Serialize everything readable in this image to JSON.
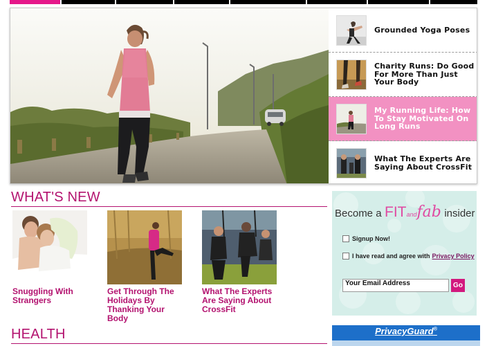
{
  "nav": {
    "items": [
      {
        "active": true
      },
      {
        "active": false
      },
      {
        "active": false
      },
      {
        "active": false
      },
      {
        "active": false
      },
      {
        "active": false
      },
      {
        "active": false
      },
      {
        "active": false
      }
    ]
  },
  "hero": {
    "image_icon": "woman-running-photo",
    "items": [
      {
        "title": "Grounded Yoga Poses",
        "active": false,
        "thumb_icon": "yoga-photo"
      },
      {
        "title": "Charity Runs: Do Good For More Than Just Your Body",
        "active": false,
        "thumb_icon": "runners-legs-photo"
      },
      {
        "title": "My Running Life: How To Stay Motivated On Long Runs",
        "active": true,
        "thumb_icon": "runner-photo"
      },
      {
        "title": "What The Experts Are Saying About CrossFit",
        "active": false,
        "thumb_icon": "crossfit-photo"
      }
    ]
  },
  "whats_new": {
    "heading": "WHAT'S NEW",
    "items": [
      {
        "title": "Snuggling With Strangers",
        "thumb_icon": "couple-in-bed-photo"
      },
      {
        "title": "Get Through The Holidays By Thanking Your Body",
        "thumb_icon": "woman-stretching-photo"
      },
      {
        "title": "What The Experts Are Saying About CrossFit",
        "thumb_icon": "crossfit-photo"
      }
    ]
  },
  "health": {
    "heading": "HEALTH"
  },
  "signup": {
    "brand_prefix": "Become a",
    "brand_fit": "FIT",
    "brand_and": "and",
    "brand_fab": "fab",
    "brand_suffix": "insider",
    "signup_label": "Signup Now!",
    "agree_label": "I have read and agree with",
    "privacy_link": "Privacy Policy",
    "email_placeholder": "Your Email Address",
    "go_label": "Go"
  },
  "ad": {
    "text": "PrivacyGuard",
    "mark": "®"
  },
  "colors": {
    "accent": "#e6188a",
    "heading": "#b3126f",
    "active_item": "#f291c2"
  }
}
